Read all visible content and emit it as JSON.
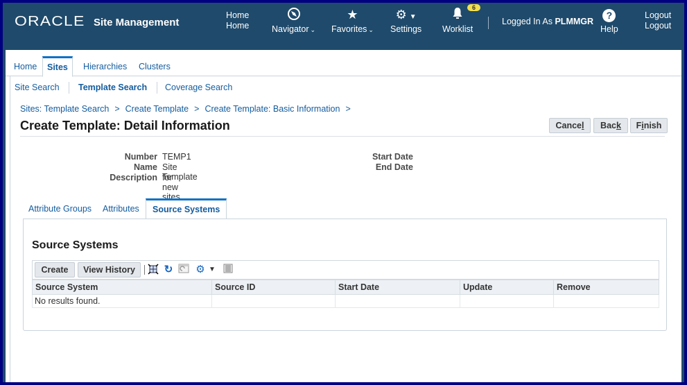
{
  "header": {
    "brand": "ORACLE",
    "app_title": "Site Management",
    "home_label_1": "Home",
    "home_label_2": "Home",
    "navigator_label": "Navigator",
    "favorites_label": "Favorites",
    "settings_label": "Settings",
    "worklist_label": "Worklist",
    "worklist_count": "6",
    "logged_in_prefix": "Logged In As",
    "username": "PLMMGR",
    "help_label": "Help",
    "logout_label_1": "Logout",
    "logout_label_2": "Logout"
  },
  "tabs": [
    {
      "label": "Home"
    },
    {
      "label": "Sites",
      "active": true
    },
    {
      "label": "Hierarchies"
    },
    {
      "label": "Clusters"
    }
  ],
  "subnav": [
    {
      "label": "Site Search"
    },
    {
      "label": "Template Search",
      "active": true
    },
    {
      "label": "Coverage Search"
    }
  ],
  "breadcrumbs": [
    "Sites: Template Search",
    "Create Template",
    "Create Template: Basic Information"
  ],
  "breadcrumb_sep": ">",
  "page_title": "Create Template: Detail Information",
  "buttons": {
    "cancel_pre": "Cance",
    "cancel_key": "l",
    "back_pre": "Bac",
    "back_key": "k",
    "finish_pre": "F",
    "finish_key": "i",
    "finish_post": "nish"
  },
  "info": {
    "number_label": "Number",
    "number_value": "TEMP1",
    "name_label": "Name",
    "name_value": "Site Template",
    "description_label": "Description",
    "description_value": "for new sites",
    "start_date_label": "Start Date",
    "start_date_value": "",
    "end_date_label": "End Date",
    "end_date_value": ""
  },
  "detail_tabs": [
    {
      "label": "Attribute Groups"
    },
    {
      "label": "Attributes"
    },
    {
      "label": "Source Systems",
      "active": true
    }
  ],
  "source_systems": {
    "title": "Source Systems",
    "create_label": "Create",
    "view_history_label": "View History",
    "columns": [
      "Source System",
      "Source ID",
      "Start Date",
      "Update",
      "Remove"
    ],
    "empty_message": "No results found."
  }
}
